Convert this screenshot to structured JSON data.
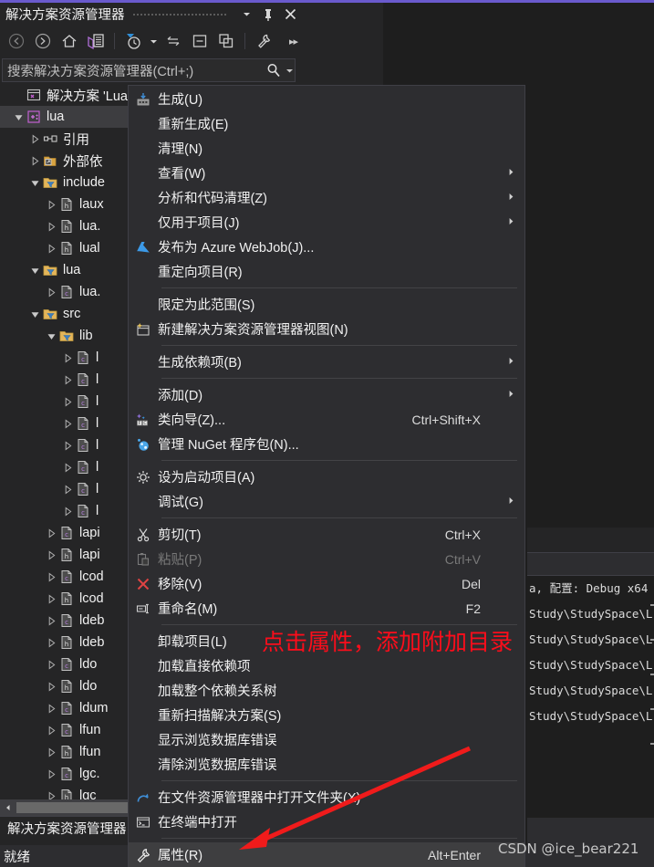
{
  "window": {
    "title": "解决方案资源管理器",
    "buttons": [
      {
        "name": "dropdown",
        "glyph": "▼"
      },
      {
        "name": "pin",
        "glyph": "pin-icon"
      },
      {
        "name": "close",
        "glyph": "✕"
      }
    ]
  },
  "toolbar": {
    "items": [
      {
        "name": "back-icon",
        "label": "后退"
      },
      {
        "name": "forward-icon",
        "label": "前进"
      },
      {
        "name": "home-icon",
        "label": "主页"
      },
      {
        "name": "sync-with-active-document-icon",
        "label": "与活动文档同步"
      },
      {
        "name": "pending-changes-filter-icon",
        "label": "挂起的更改筛选器"
      },
      {
        "name": "refresh-icon",
        "label": "刷新"
      },
      {
        "name": "collapse-all-icon",
        "label": "全部折叠"
      },
      {
        "name": "show-all-files-icon",
        "label": "显示所有文件"
      },
      {
        "name": "properties-icon",
        "label": "属性"
      }
    ],
    "overflow_label": "▸▸"
  },
  "search": {
    "placeholder": "搜索解决方案资源管理器(Ctrl+;)",
    "icon": "search-icon",
    "caret": "▾"
  },
  "tree": {
    "rows": [
      {
        "indent": 0,
        "expander": "none",
        "icon": "solution-icon",
        "label": "解决方案 'Lua",
        "selected": false
      },
      {
        "indent": 0,
        "expander": "expanded",
        "icon": "cpp-project-icon",
        "label": "lua",
        "selected": true
      },
      {
        "indent": 1,
        "expander": "collapsed",
        "icon": "references-icon",
        "label": "引用",
        "selected": false
      },
      {
        "indent": 1,
        "expander": "collapsed",
        "icon": "external-deps-icon",
        "label": "外部依",
        "selected": false
      },
      {
        "indent": 1,
        "expander": "expanded",
        "icon": "filter-folder-icon",
        "label": "include",
        "selected": false
      },
      {
        "indent": 2,
        "expander": "collapsed",
        "icon": "h-file-icon",
        "label": "laux",
        "selected": false
      },
      {
        "indent": 2,
        "expander": "collapsed",
        "icon": "h-file-icon",
        "label": "lua.",
        "selected": false
      },
      {
        "indent": 2,
        "expander": "collapsed",
        "icon": "h-file-icon",
        "label": "lual",
        "selected": false
      },
      {
        "indent": 1,
        "expander": "expanded",
        "icon": "filter-folder-icon",
        "label": "lua",
        "selected": false
      },
      {
        "indent": 2,
        "expander": "collapsed",
        "icon": "c-file-icon",
        "label": "lua.",
        "selected": false
      },
      {
        "indent": 1,
        "expander": "expanded",
        "icon": "filter-folder-icon",
        "label": "src",
        "selected": false
      },
      {
        "indent": 2,
        "expander": "expanded",
        "icon": "filter-folder-icon",
        "label": "lib",
        "selected": false
      },
      {
        "indent": 3,
        "expander": "collapsed",
        "icon": "c-file-icon",
        "label": "l",
        "selected": false
      },
      {
        "indent": 3,
        "expander": "collapsed",
        "icon": "c-file-icon",
        "label": "l",
        "selected": false
      },
      {
        "indent": 3,
        "expander": "collapsed",
        "icon": "c-file-icon",
        "label": "l",
        "selected": false
      },
      {
        "indent": 3,
        "expander": "collapsed",
        "icon": "c-file-icon",
        "label": "l",
        "selected": false
      },
      {
        "indent": 3,
        "expander": "collapsed",
        "icon": "c-file-icon",
        "label": "l",
        "selected": false
      },
      {
        "indent": 3,
        "expander": "collapsed",
        "icon": "c-file-icon",
        "label": "l",
        "selected": false
      },
      {
        "indent": 3,
        "expander": "collapsed",
        "icon": "c-file-icon",
        "label": "l",
        "selected": false
      },
      {
        "indent": 3,
        "expander": "collapsed",
        "icon": "c-file-icon",
        "label": "l",
        "selected": false
      },
      {
        "indent": 2,
        "expander": "collapsed",
        "icon": "c-file-icon",
        "label": "lapi",
        "selected": false
      },
      {
        "indent": 2,
        "expander": "collapsed",
        "icon": "h-file-icon",
        "label": "lapi",
        "selected": false
      },
      {
        "indent": 2,
        "expander": "collapsed",
        "icon": "c-file-icon",
        "label": "lcod",
        "selected": false
      },
      {
        "indent": 2,
        "expander": "collapsed",
        "icon": "h-file-icon",
        "label": "lcod",
        "selected": false
      },
      {
        "indent": 2,
        "expander": "collapsed",
        "icon": "c-file-icon",
        "label": "ldeb",
        "selected": false
      },
      {
        "indent": 2,
        "expander": "collapsed",
        "icon": "h-file-icon",
        "label": "ldeb",
        "selected": false
      },
      {
        "indent": 2,
        "expander": "collapsed",
        "icon": "c-file-icon",
        "label": "ldo",
        "selected": false
      },
      {
        "indent": 2,
        "expander": "collapsed",
        "icon": "h-file-icon",
        "label": "ldo",
        "selected": false
      },
      {
        "indent": 2,
        "expander": "collapsed",
        "icon": "c-file-icon",
        "label": "ldum",
        "selected": false
      },
      {
        "indent": 2,
        "expander": "collapsed",
        "icon": "c-file-icon",
        "label": "lfun",
        "selected": false
      },
      {
        "indent": 2,
        "expander": "collapsed",
        "icon": "h-file-icon",
        "label": "lfun",
        "selected": false
      },
      {
        "indent": 2,
        "expander": "collapsed",
        "icon": "c-file-icon",
        "label": "lgc.",
        "selected": false
      },
      {
        "indent": 2,
        "expander": "collapsed",
        "icon": "h-file-icon",
        "label": "lgc",
        "selected": false
      }
    ]
  },
  "tool_tab": {
    "label": "解决方案资源管理器"
  },
  "statusbar": {
    "text": "就绪"
  },
  "output": {
    "lines": [
      "a, 配置: Debug x64",
      "Study\\StudySpace\\L",
      "Study\\StudySpace\\L",
      "Study\\StudySpace\\L",
      "Study\\StudySpace\\L",
      "Study\\StudySpace\\L"
    ]
  },
  "context_menu": {
    "items": [
      {
        "type": "item",
        "icon": "build-icon",
        "label": "生成(U)",
        "shortcut": "",
        "submenu": false
      },
      {
        "type": "item",
        "icon": "",
        "label": "重新生成(E)",
        "shortcut": "",
        "submenu": false
      },
      {
        "type": "item",
        "icon": "",
        "label": "清理(N)",
        "shortcut": "",
        "submenu": false
      },
      {
        "type": "item",
        "icon": "",
        "label": "查看(W)",
        "shortcut": "",
        "submenu": true
      },
      {
        "type": "item",
        "icon": "",
        "label": "分析和代码清理(Z)",
        "shortcut": "",
        "submenu": true
      },
      {
        "type": "item",
        "icon": "",
        "label": "仅用于项目(J)",
        "shortcut": "",
        "submenu": true
      },
      {
        "type": "item",
        "icon": "azure-icon",
        "label": "发布为 Azure WebJob(J)...",
        "shortcut": "",
        "submenu": false
      },
      {
        "type": "item",
        "icon": "",
        "label": "重定向项目(R)",
        "shortcut": "",
        "submenu": false
      },
      {
        "type": "separator"
      },
      {
        "type": "item",
        "icon": "",
        "label": "限定为此范围(S)",
        "shortcut": "",
        "submenu": false
      },
      {
        "type": "item",
        "icon": "new-solution-view-icon",
        "label": "新建解决方案资源管理器视图(N)",
        "shortcut": "",
        "submenu": false
      },
      {
        "type": "separator"
      },
      {
        "type": "item",
        "icon": "",
        "label": "生成依赖项(B)",
        "shortcut": "",
        "submenu": true
      },
      {
        "type": "separator"
      },
      {
        "type": "item",
        "icon": "",
        "label": "添加(D)",
        "shortcut": "",
        "submenu": true
      },
      {
        "type": "item",
        "icon": "class-wizard-icon",
        "label": "类向导(Z)...",
        "shortcut": "Ctrl+Shift+X",
        "submenu": false
      },
      {
        "type": "item",
        "icon": "nuget-icon",
        "label": "管理 NuGet 程序包(N)...",
        "shortcut": "",
        "submenu": false
      },
      {
        "type": "separator"
      },
      {
        "type": "item",
        "icon": "gear-icon",
        "label": "设为启动项目(A)",
        "shortcut": "",
        "submenu": false
      },
      {
        "type": "item",
        "icon": "",
        "label": "调试(G)",
        "shortcut": "",
        "submenu": true
      },
      {
        "type": "separator"
      },
      {
        "type": "item",
        "icon": "cut-icon",
        "label": "剪切(T)",
        "shortcut": "Ctrl+X",
        "submenu": false
      },
      {
        "type": "item",
        "icon": "paste-icon",
        "label": "粘贴(P)",
        "shortcut": "Ctrl+V",
        "submenu": false,
        "disabled": true
      },
      {
        "type": "item",
        "icon": "remove-icon",
        "label": "移除(V)",
        "shortcut": "Del",
        "submenu": false
      },
      {
        "type": "item",
        "icon": "rename-icon",
        "label": "重命名(M)",
        "shortcut": "F2",
        "submenu": false
      },
      {
        "type": "separator"
      },
      {
        "type": "item",
        "icon": "",
        "label": "卸载项目(L)",
        "shortcut": "",
        "submenu": false
      },
      {
        "type": "item",
        "icon": "",
        "label": "加载直接依赖项",
        "shortcut": "",
        "submenu": false
      },
      {
        "type": "item",
        "icon": "",
        "label": "加载整个依赖关系树",
        "shortcut": "",
        "submenu": false
      },
      {
        "type": "item",
        "icon": "",
        "label": "重新扫描解决方案(S)",
        "shortcut": "",
        "submenu": false
      },
      {
        "type": "item",
        "icon": "",
        "label": "显示浏览数据库错误",
        "shortcut": "",
        "submenu": false
      },
      {
        "type": "item",
        "icon": "",
        "label": "清除浏览数据库错误",
        "shortcut": "",
        "submenu": false
      },
      {
        "type": "separator"
      },
      {
        "type": "item",
        "icon": "open-folder-icon",
        "label": "在文件资源管理器中打开文件夹(X)",
        "shortcut": "",
        "submenu": false
      },
      {
        "type": "item",
        "icon": "terminal-icon",
        "label": "在终端中打开",
        "shortcut": "",
        "submenu": false
      },
      {
        "type": "separator"
      },
      {
        "type": "item",
        "icon": "wrench-icon",
        "label": "属性(R)",
        "shortcut": "Alt+Enter",
        "submenu": false,
        "highlight": true
      }
    ]
  },
  "annotation": {
    "text": "点击属性，添加附加目录",
    "color": "#fc0d1b",
    "arrow": "red-arrow"
  },
  "watermark": {
    "text": "CSDN @ice_bear221"
  },
  "colors": {
    "accent": "#6a5acd",
    "window_bg": "#252526",
    "menu_bg": "#2d2d30",
    "editor_bg": "#1e1e1e",
    "selection": "#3d3d40",
    "annotation_red": "#fc0d1b"
  }
}
